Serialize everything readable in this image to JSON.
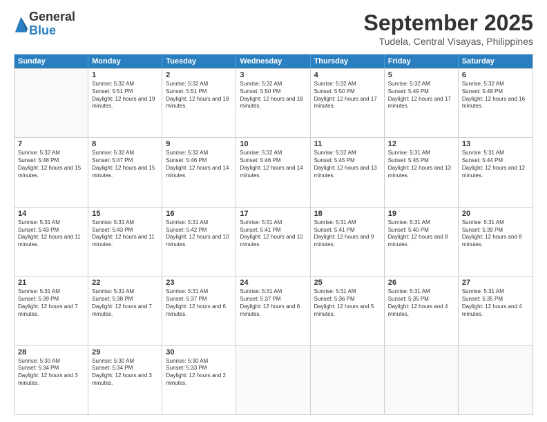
{
  "logo": {
    "general": "General",
    "blue": "Blue"
  },
  "title": "September 2025",
  "subtitle": "Tudela, Central Visayas, Philippines",
  "header_days": [
    "Sunday",
    "Monday",
    "Tuesday",
    "Wednesday",
    "Thursday",
    "Friday",
    "Saturday"
  ],
  "weeks": [
    [
      {
        "day": "",
        "sunrise": "",
        "sunset": "",
        "daylight": "",
        "empty": true
      },
      {
        "day": "1",
        "sunrise": "Sunrise: 5:32 AM",
        "sunset": "Sunset: 5:51 PM",
        "daylight": "Daylight: 12 hours and 19 minutes.",
        "empty": false
      },
      {
        "day": "2",
        "sunrise": "Sunrise: 5:32 AM",
        "sunset": "Sunset: 5:51 PM",
        "daylight": "Daylight: 12 hours and 18 minutes.",
        "empty": false
      },
      {
        "day": "3",
        "sunrise": "Sunrise: 5:32 AM",
        "sunset": "Sunset: 5:50 PM",
        "daylight": "Daylight: 12 hours and 18 minutes.",
        "empty": false
      },
      {
        "day": "4",
        "sunrise": "Sunrise: 5:32 AM",
        "sunset": "Sunset: 5:50 PM",
        "daylight": "Daylight: 12 hours and 17 minutes.",
        "empty": false
      },
      {
        "day": "5",
        "sunrise": "Sunrise: 5:32 AM",
        "sunset": "Sunset: 5:49 PM",
        "daylight": "Daylight: 12 hours and 17 minutes.",
        "empty": false
      },
      {
        "day": "6",
        "sunrise": "Sunrise: 5:32 AM",
        "sunset": "Sunset: 5:48 PM",
        "daylight": "Daylight: 12 hours and 16 minutes.",
        "empty": false
      }
    ],
    [
      {
        "day": "7",
        "sunrise": "Sunrise: 5:32 AM",
        "sunset": "Sunset: 5:48 PM",
        "daylight": "Daylight: 12 hours and 15 minutes.",
        "empty": false
      },
      {
        "day": "8",
        "sunrise": "Sunrise: 5:32 AM",
        "sunset": "Sunset: 5:47 PM",
        "daylight": "Daylight: 12 hours and 15 minutes.",
        "empty": false
      },
      {
        "day": "9",
        "sunrise": "Sunrise: 5:32 AM",
        "sunset": "Sunset: 5:46 PM",
        "daylight": "Daylight: 12 hours and 14 minutes.",
        "empty": false
      },
      {
        "day": "10",
        "sunrise": "Sunrise: 5:32 AM",
        "sunset": "Sunset: 5:46 PM",
        "daylight": "Daylight: 12 hours and 14 minutes.",
        "empty": false
      },
      {
        "day": "11",
        "sunrise": "Sunrise: 5:32 AM",
        "sunset": "Sunset: 5:45 PM",
        "daylight": "Daylight: 12 hours and 13 minutes.",
        "empty": false
      },
      {
        "day": "12",
        "sunrise": "Sunrise: 5:31 AM",
        "sunset": "Sunset: 5:45 PM",
        "daylight": "Daylight: 12 hours and 13 minutes.",
        "empty": false
      },
      {
        "day": "13",
        "sunrise": "Sunrise: 5:31 AM",
        "sunset": "Sunset: 5:44 PM",
        "daylight": "Daylight: 12 hours and 12 minutes.",
        "empty": false
      }
    ],
    [
      {
        "day": "14",
        "sunrise": "Sunrise: 5:31 AM",
        "sunset": "Sunset: 5:43 PM",
        "daylight": "Daylight: 12 hours and 11 minutes.",
        "empty": false
      },
      {
        "day": "15",
        "sunrise": "Sunrise: 5:31 AM",
        "sunset": "Sunset: 5:43 PM",
        "daylight": "Daylight: 12 hours and 11 minutes.",
        "empty": false
      },
      {
        "day": "16",
        "sunrise": "Sunrise: 5:31 AM",
        "sunset": "Sunset: 5:42 PM",
        "daylight": "Daylight: 12 hours and 10 minutes.",
        "empty": false
      },
      {
        "day": "17",
        "sunrise": "Sunrise: 5:31 AM",
        "sunset": "Sunset: 5:41 PM",
        "daylight": "Daylight: 12 hours and 10 minutes.",
        "empty": false
      },
      {
        "day": "18",
        "sunrise": "Sunrise: 5:31 AM",
        "sunset": "Sunset: 5:41 PM",
        "daylight": "Daylight: 12 hours and 9 minutes.",
        "empty": false
      },
      {
        "day": "19",
        "sunrise": "Sunrise: 5:31 AM",
        "sunset": "Sunset: 5:40 PM",
        "daylight": "Daylight: 12 hours and 8 minutes.",
        "empty": false
      },
      {
        "day": "20",
        "sunrise": "Sunrise: 5:31 AM",
        "sunset": "Sunset: 5:39 PM",
        "daylight": "Daylight: 12 hours and 8 minutes.",
        "empty": false
      }
    ],
    [
      {
        "day": "21",
        "sunrise": "Sunrise: 5:31 AM",
        "sunset": "Sunset: 5:39 PM",
        "daylight": "Daylight: 12 hours and 7 minutes.",
        "empty": false
      },
      {
        "day": "22",
        "sunrise": "Sunrise: 5:31 AM",
        "sunset": "Sunset: 5:38 PM",
        "daylight": "Daylight: 12 hours and 7 minutes.",
        "empty": false
      },
      {
        "day": "23",
        "sunrise": "Sunrise: 5:31 AM",
        "sunset": "Sunset: 5:37 PM",
        "daylight": "Daylight: 12 hours and 6 minutes.",
        "empty": false
      },
      {
        "day": "24",
        "sunrise": "Sunrise: 5:31 AM",
        "sunset": "Sunset: 5:37 PM",
        "daylight": "Daylight: 12 hours and 6 minutes.",
        "empty": false
      },
      {
        "day": "25",
        "sunrise": "Sunrise: 5:31 AM",
        "sunset": "Sunset: 5:36 PM",
        "daylight": "Daylight: 12 hours and 5 minutes.",
        "empty": false
      },
      {
        "day": "26",
        "sunrise": "Sunrise: 5:31 AM",
        "sunset": "Sunset: 5:35 PM",
        "daylight": "Daylight: 12 hours and 4 minutes.",
        "empty": false
      },
      {
        "day": "27",
        "sunrise": "Sunrise: 5:31 AM",
        "sunset": "Sunset: 5:35 PM",
        "daylight": "Daylight: 12 hours and 4 minutes.",
        "empty": false
      }
    ],
    [
      {
        "day": "28",
        "sunrise": "Sunrise: 5:30 AM",
        "sunset": "Sunset: 5:34 PM",
        "daylight": "Daylight: 12 hours and 3 minutes.",
        "empty": false
      },
      {
        "day": "29",
        "sunrise": "Sunrise: 5:30 AM",
        "sunset": "Sunset: 5:34 PM",
        "daylight": "Daylight: 12 hours and 3 minutes.",
        "empty": false
      },
      {
        "day": "30",
        "sunrise": "Sunrise: 5:30 AM",
        "sunset": "Sunset: 5:33 PM",
        "daylight": "Daylight: 12 hours and 2 minutes.",
        "empty": false
      },
      {
        "day": "",
        "sunrise": "",
        "sunset": "",
        "daylight": "",
        "empty": true
      },
      {
        "day": "",
        "sunrise": "",
        "sunset": "",
        "daylight": "",
        "empty": true
      },
      {
        "day": "",
        "sunrise": "",
        "sunset": "",
        "daylight": "",
        "empty": true
      },
      {
        "day": "",
        "sunrise": "",
        "sunset": "",
        "daylight": "",
        "empty": true
      }
    ]
  ]
}
